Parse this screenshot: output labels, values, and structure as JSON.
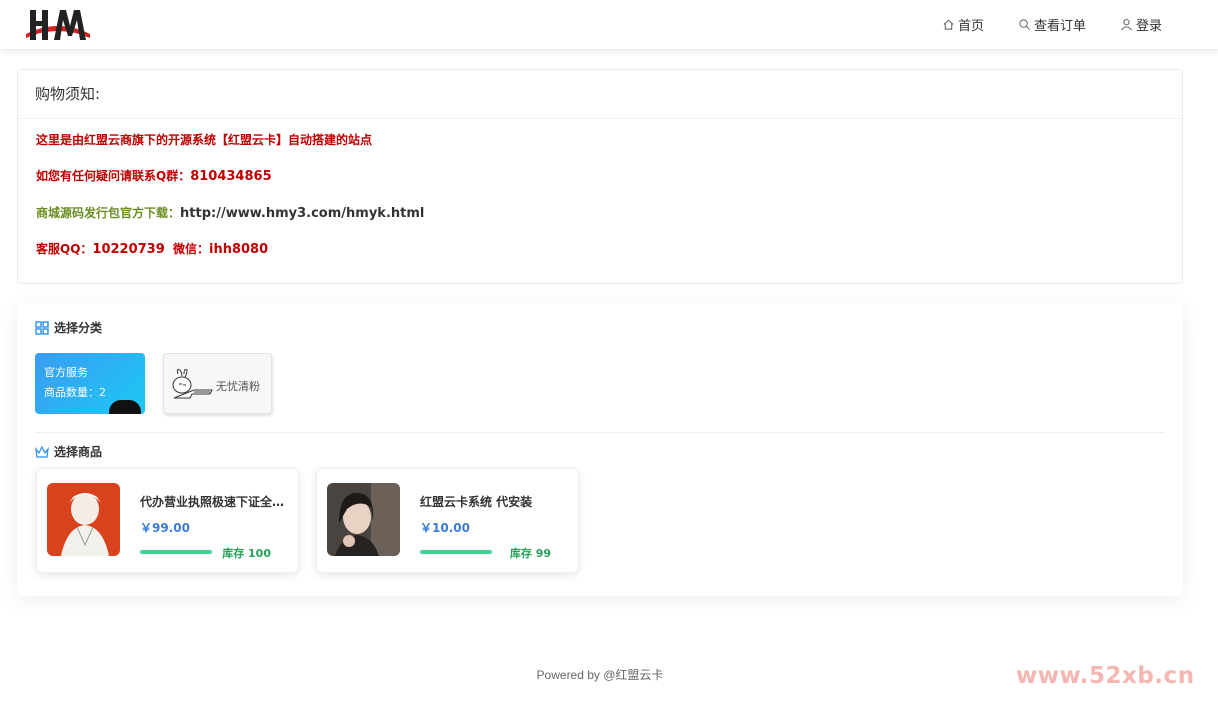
{
  "header": {
    "logo_text": "HM",
    "nav": [
      {
        "label": "首页",
        "icon": "home-icon"
      },
      {
        "label": "查看订单",
        "icon": "search-icon"
      },
      {
        "label": "登录",
        "icon": "user-icon"
      }
    ]
  },
  "notice": {
    "title": "购物须知:",
    "line1": "这里是由红盟云商旗下的开源系统【红盟云卡】自动搭建的站点",
    "line2_prefix": "如您有任何疑问请联系Q群：",
    "line2_value": "810434865",
    "line3_prefix": "商城源码发行包官方下载：",
    "line3_value": "http://www.hmy3.com/hmyk.html",
    "line4_prefix": "客服QQ：",
    "line4_qq": "10220739",
    "line4_wx_prefix": "微信：",
    "line4_wx": "ihh8080"
  },
  "shop": {
    "category_title": "选择分类",
    "categories": [
      {
        "name": "官方服务",
        "count_label": "商品数量：2"
      },
      {
        "name": "无忧清粉"
      }
    ],
    "goods_title": "选择商品",
    "goods": [
      {
        "name": "代办营业执照极速下证全…",
        "price": "￥99.00",
        "stock": "库存 100"
      },
      {
        "name": "红盟云卡系统 代安装",
        "price": "￥10.00",
        "stock": "库存 99"
      }
    ]
  },
  "footer": {
    "text": "Powered by @红盟云卡"
  },
  "watermark": "www.52xb.cn",
  "colors": {
    "accent_blue": "#3a7bd5",
    "notice_red": "#c00000",
    "stock_green": "#23a35a"
  }
}
